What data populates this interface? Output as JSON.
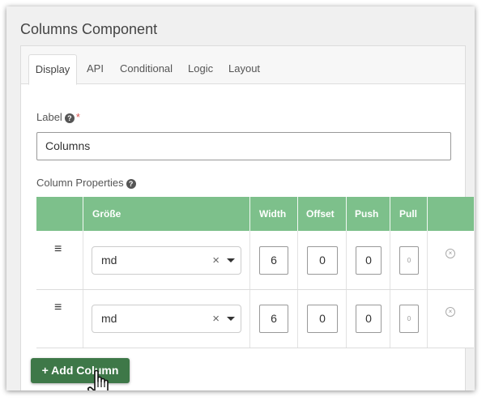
{
  "title": "Columns Component",
  "tabs": [
    {
      "label": "Display",
      "active": true
    },
    {
      "label": "API",
      "active": false
    },
    {
      "label": "Conditional",
      "active": false
    },
    {
      "label": "Logic",
      "active": false
    },
    {
      "label": "Layout",
      "active": false
    }
  ],
  "label_field": {
    "label": "Label",
    "required_mark": "*",
    "value": "Columns"
  },
  "column_properties": {
    "label": "Column Properties",
    "headers": [
      "Größe",
      "Width",
      "Offset",
      "Push",
      "Pull"
    ],
    "rows": [
      {
        "size": "md",
        "width": "6",
        "offset": "0",
        "push": "0",
        "pull": "0"
      },
      {
        "size": "md",
        "width": "6",
        "offset": "0",
        "push": "0",
        "pull": "0"
      }
    ]
  },
  "add_button": {
    "icon": "plus-icon",
    "label": "Add Column"
  },
  "icons": {
    "drag": "drag-handle-icon",
    "clear": "clear-icon",
    "dropdown": "chevron-down-icon",
    "remove": "remove-icon",
    "help": "question-circle-icon",
    "cursor": "hand-pointer-icon"
  },
  "colors": {
    "header_green": "#7dc08b",
    "button_green": "#3e7848",
    "required_red": "#d9534f"
  }
}
